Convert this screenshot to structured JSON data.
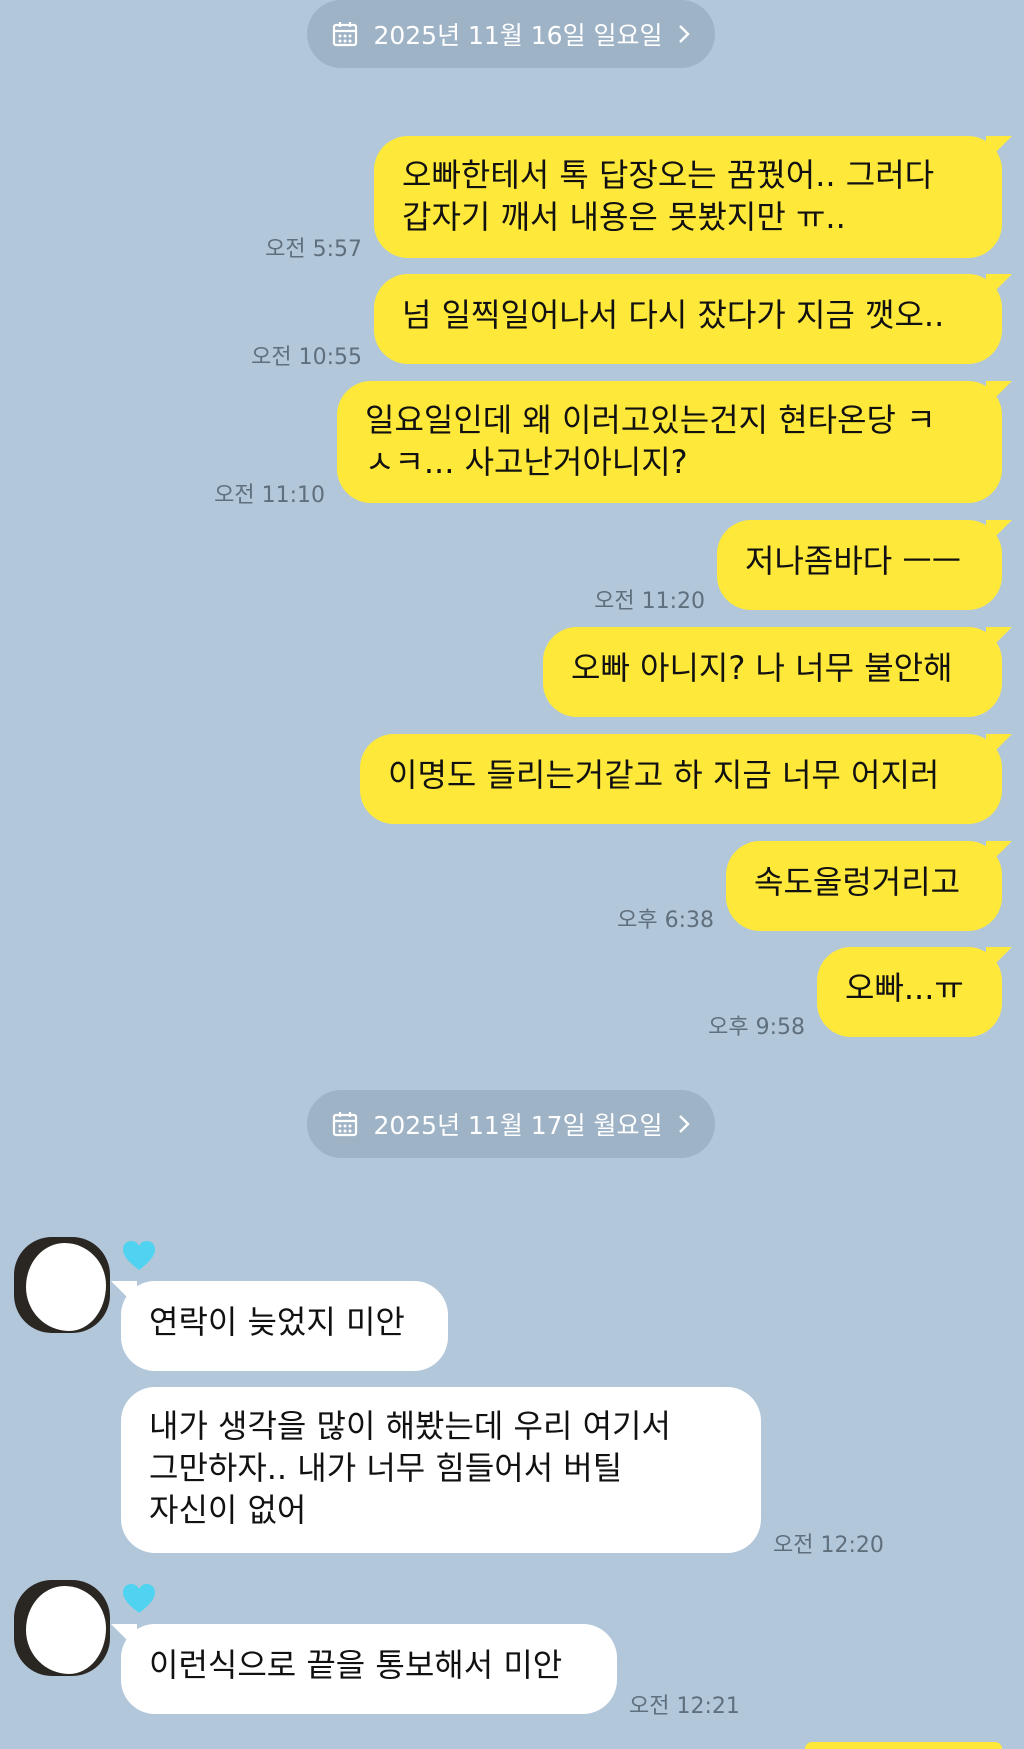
{
  "dates": [
    {
      "label": "2025년 11월 16일 일요일"
    },
    {
      "label": "2025년 11월 17일 월요일"
    }
  ],
  "sent": [
    {
      "lines": [
        "오빠한테서 톡 답장오는 꿈꿨어.. 그러다",
        "갑자기 깨서 내용은 못봤지만 ㅠ.."
      ],
      "time": "오전 5:57"
    },
    {
      "lines": [
        "넘 일찍일어나서 다시 잤다가 지금 깻오.."
      ],
      "time": "오전 10:55"
    },
    {
      "lines": [
        "일요일인데 왜 이러고있는건지 현타온당 ㅋ",
        "ㅅㅋ... 사고난거아니지?"
      ],
      "time": "오전 11:10"
    },
    {
      "lines": [
        "저나좀바다 ㅡㅡ"
      ],
      "time": "오전 11:20"
    },
    {
      "lines": [
        "오빠 아니지? 나 너무 불안해"
      ],
      "time": ""
    },
    {
      "lines": [
        "이명도 들리는거같고 하 지금 너무 어지러"
      ],
      "time": ""
    },
    {
      "lines": [
        "속도울렁거리고"
      ],
      "time": "오후 6:38"
    },
    {
      "lines": [
        "오빠...ㅠ"
      ],
      "time": "오후 9:58"
    }
  ],
  "received": [
    {
      "lines": [
        "연락이 늦었지 미안"
      ],
      "time": ""
    },
    {
      "lines": [
        "내가 생각을 많이 해봤는데 우리 여기서",
        "그만하자.. 내가 너무 힘들어서 버틸",
        "자신이 없어"
      ],
      "time": "오전 12:20"
    },
    {
      "lines": [
        "이런식으로 끝을 통보해서 미안"
      ],
      "time": "오전 12:21"
    }
  ],
  "icons": {
    "calendar": "calendar-icon",
    "chevron": "chevron-right-icon",
    "heart": "heart-icon",
    "heart_color": "#4fd3f0"
  },
  "colors": {
    "background": "#b2c7da",
    "sent_bubble": "#fee83a",
    "received_bubble": "#ffffff",
    "date_pill": "#9fb3c6"
  }
}
